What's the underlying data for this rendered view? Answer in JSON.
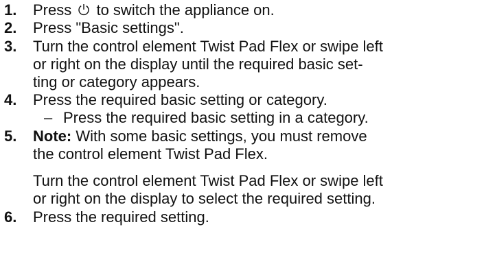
{
  "steps": [
    {
      "number": "1.",
      "text_before_icon": "Press ",
      "icon": "power-icon",
      "text_after_icon": " to switch the appliance on."
    },
    {
      "number": "2.",
      "text": "Press \"Basic settings\"."
    },
    {
      "number": "3.",
      "lines": [
        "Turn the control element Twist Pad Flex or swipe left",
        "or right on the display until the required basic set-",
        "ting or category appears."
      ]
    },
    {
      "number": "4.",
      "text": "Press the required basic setting or category.",
      "sub": {
        "dash": "–",
        "text": "Press the required basic setting in a category."
      }
    },
    {
      "number": "5.",
      "note_label": "Note:",
      "note_first": " With some basic settings, you must remove",
      "note_second": "the control element Twist Pad Flex.",
      "para": [
        "Turn the control element Twist Pad Flex or swipe left",
        "or right on the display to select the required setting."
      ]
    },
    {
      "number": "6.",
      "text": "Press the required setting."
    }
  ]
}
